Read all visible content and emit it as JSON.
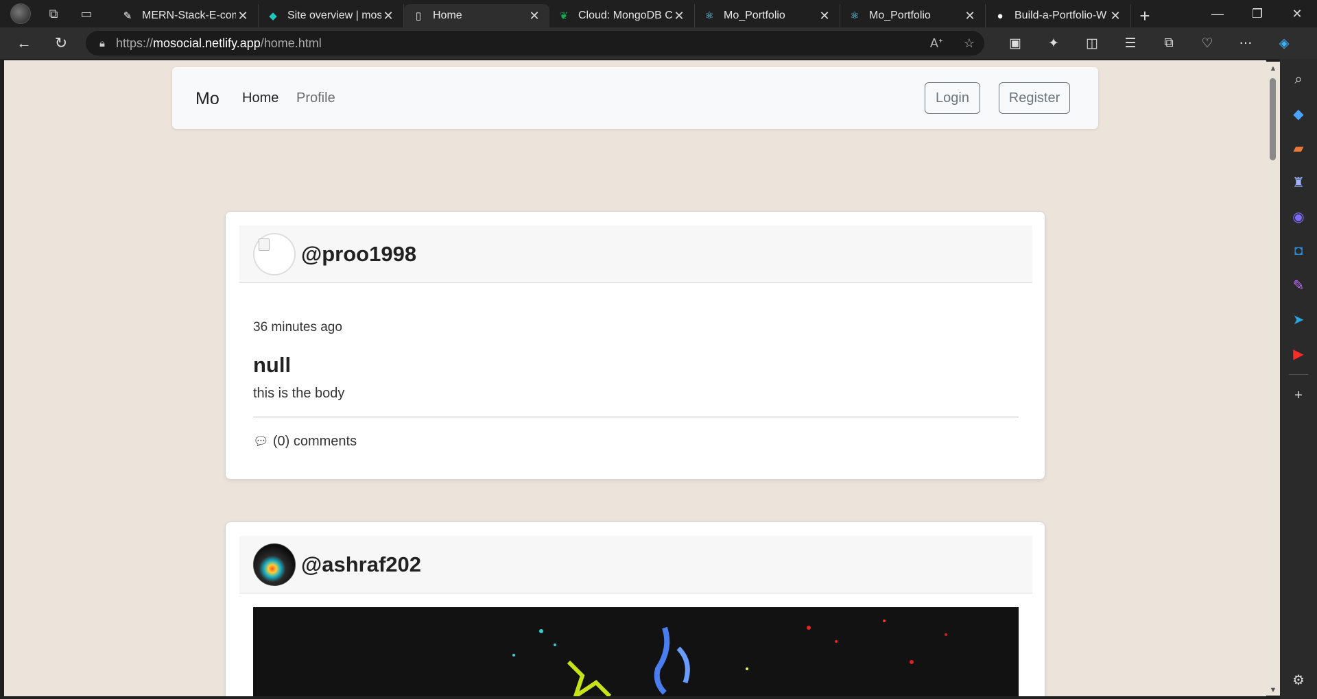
{
  "browser": {
    "tabs": [
      {
        "label": "MERN-Stack-E-com",
        "icon": "edit-doc-icon",
        "active": false
      },
      {
        "label": "Site overview | mos",
        "icon": "netlify-icon",
        "active": false
      },
      {
        "label": "Home",
        "icon": "page-icon",
        "active": true
      },
      {
        "label": "Cloud: MongoDB Cl",
        "icon": "mongodb-leaf-icon",
        "active": false
      },
      {
        "label": "Mo_Portfolio",
        "icon": "react-icon",
        "active": false
      },
      {
        "label": "Mo_Portfolio",
        "icon": "react-icon",
        "active": false
      },
      {
        "label": "Build-a-Portfolio-W",
        "icon": "github-icon",
        "active": false
      }
    ],
    "url_prefix": "https://",
    "url_host": "mosocial.netlify.app",
    "url_path": "/home.html"
  },
  "site": {
    "brand": "Mo",
    "nav": {
      "home": "Home",
      "profile": "Profile"
    },
    "login": "Login",
    "register": "Register"
  },
  "posts": [
    {
      "username": "@proo1998",
      "time": "36 minutes ago",
      "title": "null",
      "body": "this is the body",
      "comments": "(0) comments"
    },
    {
      "username": "@ashraf202"
    }
  ],
  "colors": {
    "page_bg": "#ece4da",
    "navbar_bg": "#f8f9fa",
    "outline_btn": "#6c757d"
  }
}
